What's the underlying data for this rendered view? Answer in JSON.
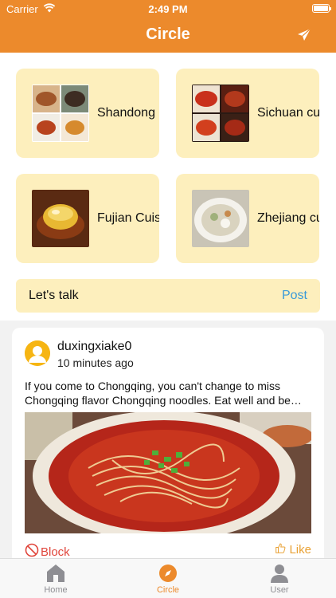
{
  "status_bar": {
    "carrier": "Carrier",
    "time": "2:49 PM"
  },
  "nav": {
    "title": "Circle",
    "action_icon": "paper-plane-icon"
  },
  "categories": [
    {
      "label": "Shandong cuisine"
    },
    {
      "label": "Sichuan cuisine"
    },
    {
      "label": "Fujian Cuisine"
    },
    {
      "label": "Zhejiang cuisine"
    }
  ],
  "talk": {
    "label": "Let's talk",
    "post_label": "Post"
  },
  "post": {
    "username": "duxingxiake0",
    "time": "10 minutes ago",
    "text": "If you come to Chongqing, you can't change to miss Chongqing flavor Chongqing noodles. Eat well and be satisfied with every bite of the noodles you eat here in Chongqing.",
    "block_label": "Block",
    "like_label": "Like"
  },
  "tabs": [
    {
      "label": "Home",
      "icon": "home-icon"
    },
    {
      "label": "Circle",
      "icon": "compass-icon",
      "active": true
    },
    {
      "label": "User",
      "icon": "user-icon"
    }
  ],
  "colors": {
    "accent": "#ec8a2c",
    "card": "#fdefbd",
    "link": "#3a9ad9",
    "block": "#e0463c",
    "like": "#e9a236"
  }
}
